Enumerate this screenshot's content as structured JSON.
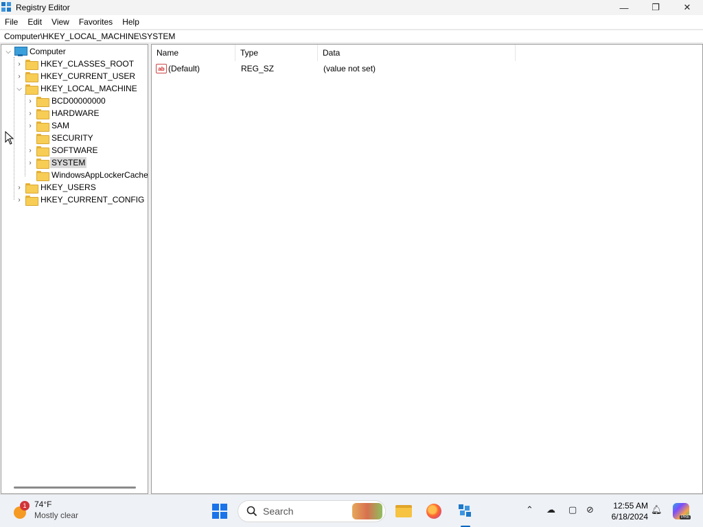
{
  "window": {
    "title": "Registry Editor",
    "controls": {
      "minimize": "—",
      "maximize": "❐",
      "close": "✕"
    }
  },
  "menu": [
    "File",
    "Edit",
    "View",
    "Favorites",
    "Help"
  ],
  "address": "Computer\\HKEY_LOCAL_MACHINE\\SYSTEM",
  "tree": {
    "root": "Computer",
    "items": [
      {
        "label": "HKEY_CLASSES_ROOT",
        "level": 1,
        "expandable": true,
        "expanded": false
      },
      {
        "label": "HKEY_CURRENT_USER",
        "level": 1,
        "expandable": true,
        "expanded": false
      },
      {
        "label": "HKEY_LOCAL_MACHINE",
        "level": 1,
        "expandable": true,
        "expanded": true
      },
      {
        "label": "BCD00000000",
        "level": 2,
        "expandable": true,
        "expanded": false
      },
      {
        "label": "HARDWARE",
        "level": 2,
        "expandable": true,
        "expanded": false
      },
      {
        "label": "SAM",
        "level": 2,
        "expandable": true,
        "expanded": false
      },
      {
        "label": "SECURITY",
        "level": 2,
        "expandable": false,
        "expanded": false
      },
      {
        "label": "SOFTWARE",
        "level": 2,
        "expandable": true,
        "expanded": false
      },
      {
        "label": "SYSTEM",
        "level": 2,
        "expandable": true,
        "expanded": false,
        "selected": true
      },
      {
        "label": "WindowsAppLockerCache",
        "level": 2,
        "expandable": false,
        "expanded": false
      },
      {
        "label": "HKEY_USERS",
        "level": 1,
        "expandable": true,
        "expanded": false
      },
      {
        "label": "HKEY_CURRENT_CONFIG",
        "level": 1,
        "expandable": true,
        "expanded": false
      }
    ]
  },
  "values_list": {
    "columns": [
      "Name",
      "Type",
      "Data"
    ],
    "rows": [
      {
        "icon": "string-value-icon",
        "name": "(Default)",
        "type": "REG_SZ",
        "data": "(value not set)"
      }
    ]
  },
  "taskbar": {
    "weather": {
      "temp": "74°F",
      "desc": "Mostly clear",
      "badge": "1"
    },
    "search_label": "Search",
    "clock": {
      "time": "12:55 AM",
      "date": "6/18/2024"
    },
    "copilot_badge": "PRE"
  }
}
